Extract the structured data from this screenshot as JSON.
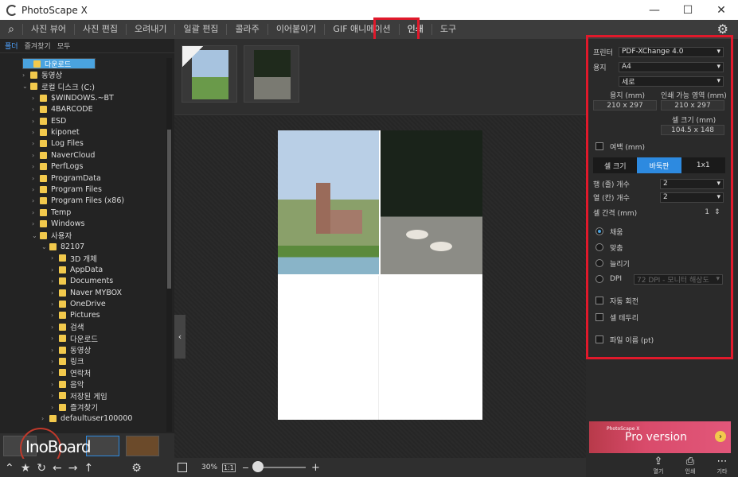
{
  "app": {
    "title": "PhotoScape X"
  },
  "window": {
    "minimize": "—",
    "maximize": "☐",
    "close": "✕"
  },
  "menu": {
    "items": [
      "사진 뷰어",
      "사진 편집",
      "오려내기",
      "일괄 편집",
      "콜라주",
      "이어붙이기",
      "GIF 애니메이션",
      "인쇄",
      "도구"
    ]
  },
  "left": {
    "tabs": [
      "폴더",
      "즐겨찾기",
      "모두"
    ],
    "tree": [
      {
        "label": "다운로드",
        "indent": 0,
        "arrow": ""
      },
      {
        "label": "동영상",
        "indent": 0,
        "arrow": "›"
      },
      {
        "label": "로컬 디스크 (C:)",
        "indent": 0,
        "arrow": "⌄"
      },
      {
        "label": "$WINDOWS.~BT",
        "indent": 1,
        "arrow": "›"
      },
      {
        "label": "4BARCODE",
        "indent": 1,
        "arrow": "›"
      },
      {
        "label": "ESD",
        "indent": 1,
        "arrow": "›"
      },
      {
        "label": "kiponet",
        "indent": 1,
        "arrow": "›"
      },
      {
        "label": "Log Files",
        "indent": 1,
        "arrow": "›"
      },
      {
        "label": "NaverCloud",
        "indent": 1,
        "arrow": "›"
      },
      {
        "label": "PerfLogs",
        "indent": 1,
        "arrow": "›"
      },
      {
        "label": "ProgramData",
        "indent": 1,
        "arrow": "›"
      },
      {
        "label": "Program Files",
        "indent": 1,
        "arrow": "›"
      },
      {
        "label": "Program Files (x86)",
        "indent": 1,
        "arrow": "›"
      },
      {
        "label": "Temp",
        "indent": 1,
        "arrow": "›"
      },
      {
        "label": "Windows",
        "indent": 1,
        "arrow": "›"
      },
      {
        "label": "사용자",
        "indent": 1,
        "arrow": "⌄"
      },
      {
        "label": "82107",
        "indent": 2,
        "arrow": "⌄"
      },
      {
        "label": "3D 개체",
        "indent": 3,
        "arrow": "›"
      },
      {
        "label": "AppData",
        "indent": 3,
        "arrow": "›"
      },
      {
        "label": "Documents",
        "indent": 3,
        "arrow": "›"
      },
      {
        "label": "Naver MYBOX",
        "indent": 3,
        "arrow": "›"
      },
      {
        "label": "OneDrive",
        "indent": 3,
        "arrow": "›"
      },
      {
        "label": "Pictures",
        "indent": 3,
        "arrow": "›"
      },
      {
        "label": "검색",
        "indent": 3,
        "arrow": "›"
      },
      {
        "label": "다운로드",
        "indent": 3,
        "arrow": "›"
      },
      {
        "label": "동영상",
        "indent": 3,
        "arrow": "›"
      },
      {
        "label": "링크",
        "indent": 3,
        "arrow": "›"
      },
      {
        "label": "연락처",
        "indent": 3,
        "arrow": "›"
      },
      {
        "label": "음악",
        "indent": 3,
        "arrow": "›"
      },
      {
        "label": "저장된 게임",
        "indent": 3,
        "arrow": "›"
      },
      {
        "label": "즐겨찾기",
        "indent": 3,
        "arrow": "›"
      },
      {
        "label": "defaultuser100000",
        "indent": 2,
        "arrow": "›"
      }
    ],
    "watermark": "InoBoard"
  },
  "center": {
    "zoom": "30%",
    "ratio": "1:1",
    "plus": "+",
    "minus": "−"
  },
  "right": {
    "printer_label": "프린터",
    "printer_value": "PDF-XChange 4.0",
    "paper_label": "용지",
    "paper_value": "A4",
    "orient_value": "세로",
    "paper_size_label": "용지 (mm)",
    "paper_size_value": "210 x 297",
    "print_area_label": "인쇄 가능 영역 (mm)",
    "print_area_value": "210 x 297",
    "cell_size_label": "셀 크기 (mm)",
    "cell_size_value": "104.5 x 148",
    "margin_label": "여백 (mm)",
    "seg": [
      "셀 크기",
      "바둑판",
      "1x1"
    ],
    "rows_label": "행 (줄) 개수",
    "rows_value": "2",
    "cols_label": "열 (칸) 개수",
    "cols_value": "2",
    "spacing_label": "셀 간격 (mm)",
    "spacing_value": "1",
    "fill_label": "채움",
    "fit_label": "맞춤",
    "stretch_label": "늘리기",
    "dpi_label": "DPI",
    "dpi_value": "72 DPI - 모니터 해상도",
    "auto_rotate": "자동 회전",
    "cell_border": "셀 테두리",
    "file_name": "파일 이름 (pt)",
    "promo_small": "PhotoScape X",
    "promo_text": "Pro version",
    "btns": [
      "열기",
      "인쇄",
      "기타"
    ]
  },
  "colors": {
    "accent": "#2d8ae0",
    "highlight": "#e0192b"
  }
}
